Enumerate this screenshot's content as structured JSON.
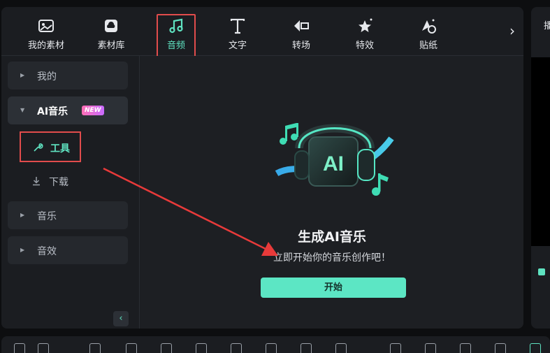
{
  "toolbar": {
    "tabs": [
      {
        "label": "我的素材",
        "icon": "image-icon"
      },
      {
        "label": "素材库",
        "icon": "cloud-icon"
      },
      {
        "label": "音频",
        "icon": "music-note-icon",
        "active": true
      },
      {
        "label": "文字",
        "icon": "text-icon"
      },
      {
        "label": "转场",
        "icon": "transition-icon"
      },
      {
        "label": "特效",
        "icon": "sparkle-star-icon"
      },
      {
        "label": "贴纸",
        "icon": "sticker-icon"
      }
    ],
    "more": "›"
  },
  "sidebar": {
    "my": "我的",
    "ai_music": "AI音乐",
    "new_badge": "NEW",
    "tools": "工具",
    "download": "下载",
    "music": "音乐",
    "sfx": "音效",
    "collapse": "‹"
  },
  "main": {
    "hero_label": "AI",
    "title": "生成AI音乐",
    "subtitle": "立即开始你的音乐创作吧！",
    "start_button": "开始"
  },
  "right_panel": {
    "tab_initial": "播"
  },
  "colors": {
    "accent": "#5ce6c4",
    "highlight_box": "#e14c4c",
    "panel": "#1b1d21",
    "badge_gradient": [
      "#ff6fb5",
      "#c86bff"
    ]
  }
}
